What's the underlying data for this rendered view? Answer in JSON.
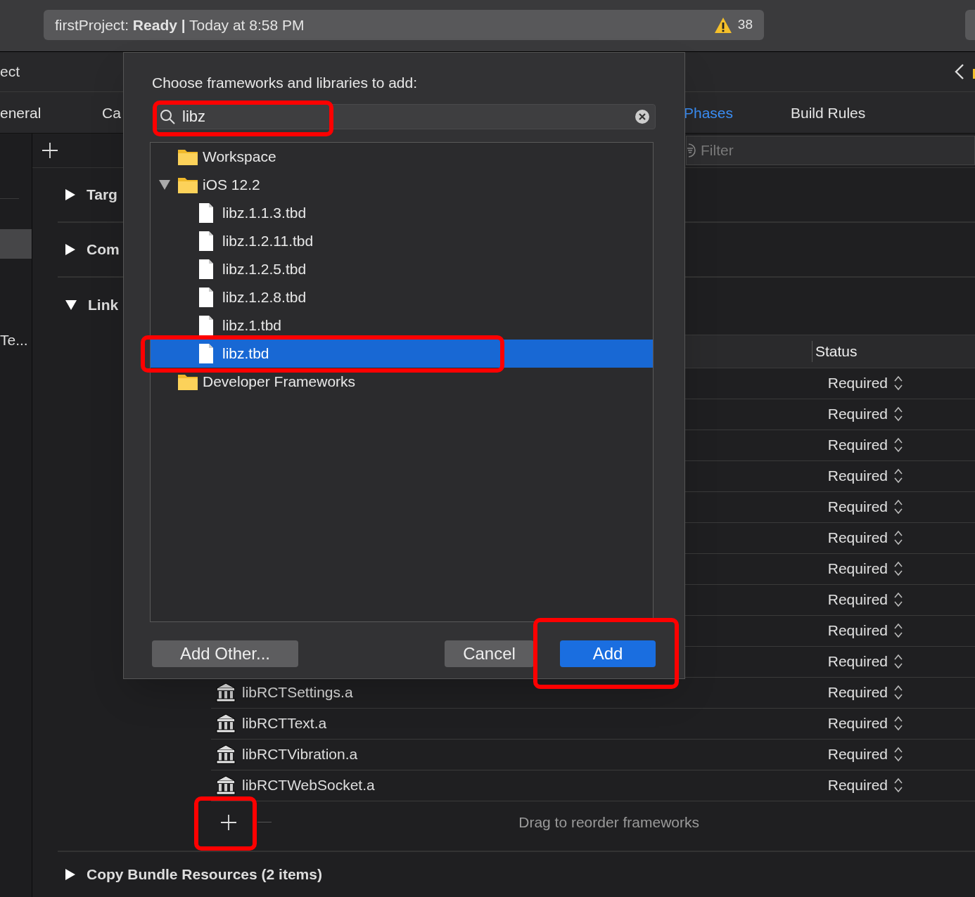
{
  "toolbar": {
    "status": {
      "project": "firstProject:",
      "state": "Ready",
      "separator": "|",
      "time": "Today at 8:58 PM"
    },
    "warning_count": "38"
  },
  "editor": {
    "title": "ect",
    "tabs": [
      {
        "label": "eneral",
        "selected": false
      },
      {
        "label": "Ca",
        "selected": false
      },
      {
        "label": "Phases",
        "selected": true
      },
      {
        "label": "Build Rules",
        "selected": false
      }
    ],
    "filter": {
      "placeholder": "Filter"
    }
  },
  "sidebar": {
    "label": "Te..."
  },
  "phases": [
    {
      "title": "Targ",
      "expanded": false
    },
    {
      "title": "Com",
      "expanded": false
    },
    {
      "title": "Link",
      "expanded": true
    }
  ],
  "link_table": {
    "status_header": "Status",
    "rows": [
      {
        "status": "Required"
      },
      {
        "status": "Required"
      },
      {
        "status": "Required"
      },
      {
        "status": "Required"
      },
      {
        "status": "Required"
      },
      {
        "status": "Required"
      },
      {
        "status": "Required"
      },
      {
        "status": "Required"
      },
      {
        "status": "Required"
      },
      {
        "status": "Required"
      },
      {
        "name": "libRCTSettings.a",
        "status": "Required"
      },
      {
        "name": "libRCTText.a",
        "status": "Required"
      },
      {
        "name": "libRCTVibration.a",
        "status": "Required"
      },
      {
        "name": "libRCTWebSocket.a",
        "status": "Required"
      }
    ],
    "hint": "Drag to reorder frameworks"
  },
  "copy_phase": {
    "title": "Copy Bundle Resources (2 items)",
    "expanded": false
  },
  "dialog": {
    "prompt": "Choose frameworks and libraries to add:",
    "search": {
      "value": "libz"
    },
    "tree": [
      {
        "label": "Workspace",
        "kind": "folder",
        "selected": false
      },
      {
        "label": "iOS 12.2",
        "kind": "folder",
        "expanded": true,
        "selected": false,
        "children": [
          {
            "label": "libz.1.1.3.tbd",
            "kind": "file",
            "selected": false
          },
          {
            "label": "libz.1.2.11.tbd",
            "kind": "file",
            "selected": false
          },
          {
            "label": "libz.1.2.5.tbd",
            "kind": "file",
            "selected": false
          },
          {
            "label": "libz.1.2.8.tbd",
            "kind": "file",
            "selected": false
          },
          {
            "label": "libz.1.tbd",
            "kind": "file",
            "selected": false
          },
          {
            "label": "libz.tbd",
            "kind": "file",
            "selected": true
          }
        ]
      },
      {
        "label": "Developer Frameworks",
        "kind": "folder",
        "selected": false
      }
    ],
    "buttons": [
      {
        "label": "Add Other...",
        "kind": "secondary"
      },
      {
        "label": "Cancel",
        "kind": "secondary"
      },
      {
        "label": "Add",
        "kind": "primary"
      }
    ]
  }
}
